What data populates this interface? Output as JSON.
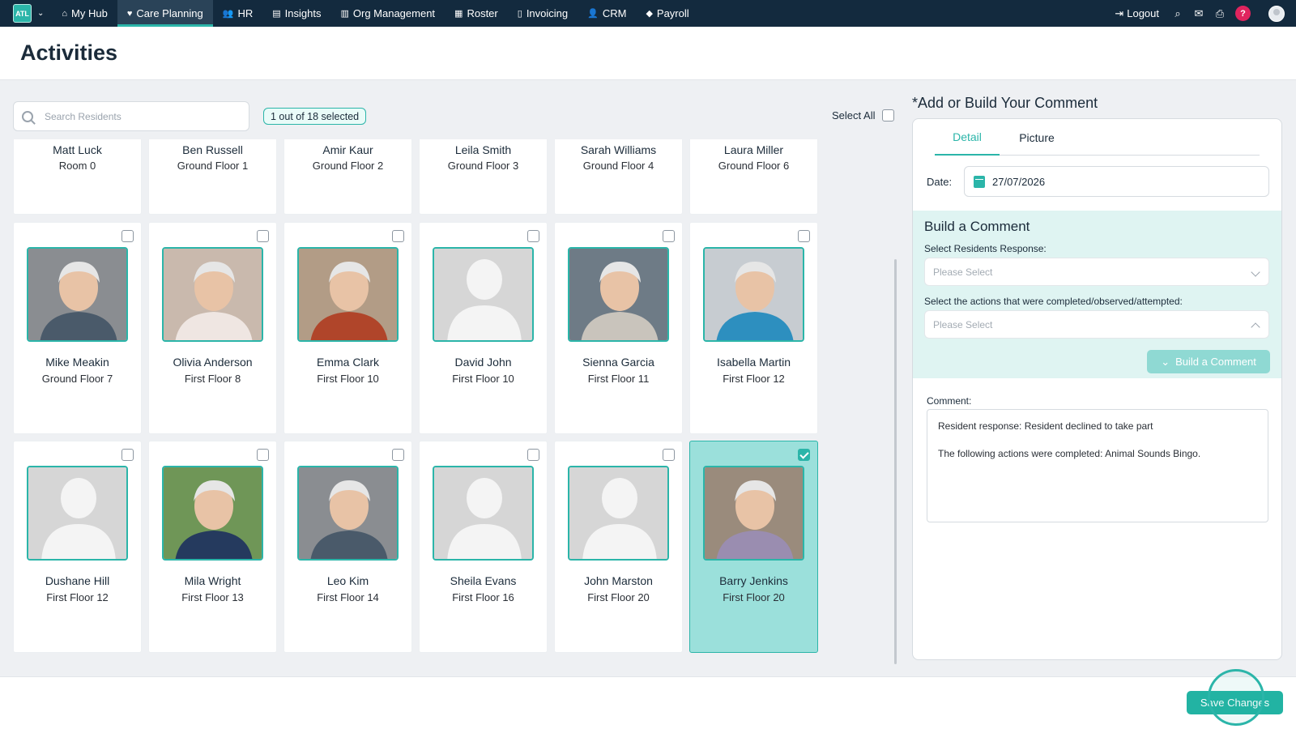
{
  "nav": {
    "brand": "ATL",
    "items": [
      {
        "label": "My Hub",
        "icon": "home-icon",
        "glyph": "⌂"
      },
      {
        "label": "Care Planning",
        "icon": "heart-icon",
        "glyph": "♥",
        "active": true
      },
      {
        "label": "HR",
        "icon": "users-icon",
        "glyph": "👥"
      },
      {
        "label": "Insights",
        "icon": "chart-icon",
        "glyph": "▤"
      },
      {
        "label": "Org Management",
        "icon": "building-icon",
        "glyph": "▥"
      },
      {
        "label": "Roster",
        "icon": "calendar-icon",
        "glyph": "▦"
      },
      {
        "label": "Invoicing",
        "icon": "invoice-icon",
        "glyph": "▯"
      },
      {
        "label": "CRM",
        "icon": "contacts-icon",
        "glyph": "👤"
      },
      {
        "label": "Payroll",
        "icon": "tag-icon",
        "glyph": "◆"
      }
    ],
    "logout": "Logout",
    "help": "?"
  },
  "page": {
    "title": "Activities"
  },
  "search": {
    "placeholder": "Search Residents"
  },
  "selection": {
    "badge": "1 out of 18 selected",
    "select_all": "Select All"
  },
  "residents_row0": [
    {
      "name": "Matt Luck",
      "room": "Room 0"
    },
    {
      "name": "Ben Russell",
      "room": "Ground Floor 1"
    },
    {
      "name": "Amir Kaur",
      "room": "Ground Floor 2"
    },
    {
      "name": "Leila Smith",
      "room": "Ground Floor 3"
    },
    {
      "name": "Sarah Williams",
      "room": "Ground Floor 4"
    },
    {
      "name": "Laura Miller",
      "room": "Ground Floor 6"
    }
  ],
  "residents_row1": [
    {
      "name": "Mike Meakin",
      "room": "Ground Floor 7",
      "photo": true
    },
    {
      "name": "Olivia Anderson",
      "room": "First Floor 8",
      "photo": true
    },
    {
      "name": "Emma Clark",
      "room": "First Floor 10",
      "photo": true
    },
    {
      "name": "David John",
      "room": "First Floor 10",
      "photo": false
    },
    {
      "name": "Sienna Garcia",
      "room": "First Floor 11",
      "photo": true
    },
    {
      "name": "Isabella Martin",
      "room": "First Floor 12",
      "photo": true
    }
  ],
  "residents_row2": [
    {
      "name": "Dushane Hill",
      "room": "First Floor 12",
      "photo": false
    },
    {
      "name": "Mila Wright",
      "room": "First Floor 13",
      "photo": true
    },
    {
      "name": "Leo Kim",
      "room": "First Floor 14",
      "photo": true
    },
    {
      "name": "Sheila Evans",
      "room": "First Floor 16",
      "photo": false
    },
    {
      "name": "John Marston",
      "room": "First Floor 20",
      "photo": false
    },
    {
      "name": "Barry Jenkins",
      "room": "First Floor 20",
      "photo": true,
      "selected": true
    }
  ],
  "panel": {
    "title": "*Add or Build Your Comment",
    "tabs": [
      "Detail",
      "Picture"
    ],
    "date_label": "Date:",
    "date_value": "27/07/2026",
    "build_title": "Build a Comment",
    "response_label": "Select Residents Response:",
    "response_placeholder": "Please Select",
    "actions_label": "Select the actions that were completed/observed/attempted:",
    "actions_placeholder": "Please Select",
    "build_button": "Build a Comment",
    "comment_label": "Comment:",
    "comment_line1": "Resident response: Resident declined to take part",
    "comment_line2": "The following actions were completed: Animal Sounds Bingo."
  },
  "footer": {
    "save": "Save Changes"
  },
  "colors": {
    "accent": "#2bb5a9",
    "nav_bg": "#132a3e",
    "selected_card": "#9be0db",
    "help": "#e0245e"
  }
}
